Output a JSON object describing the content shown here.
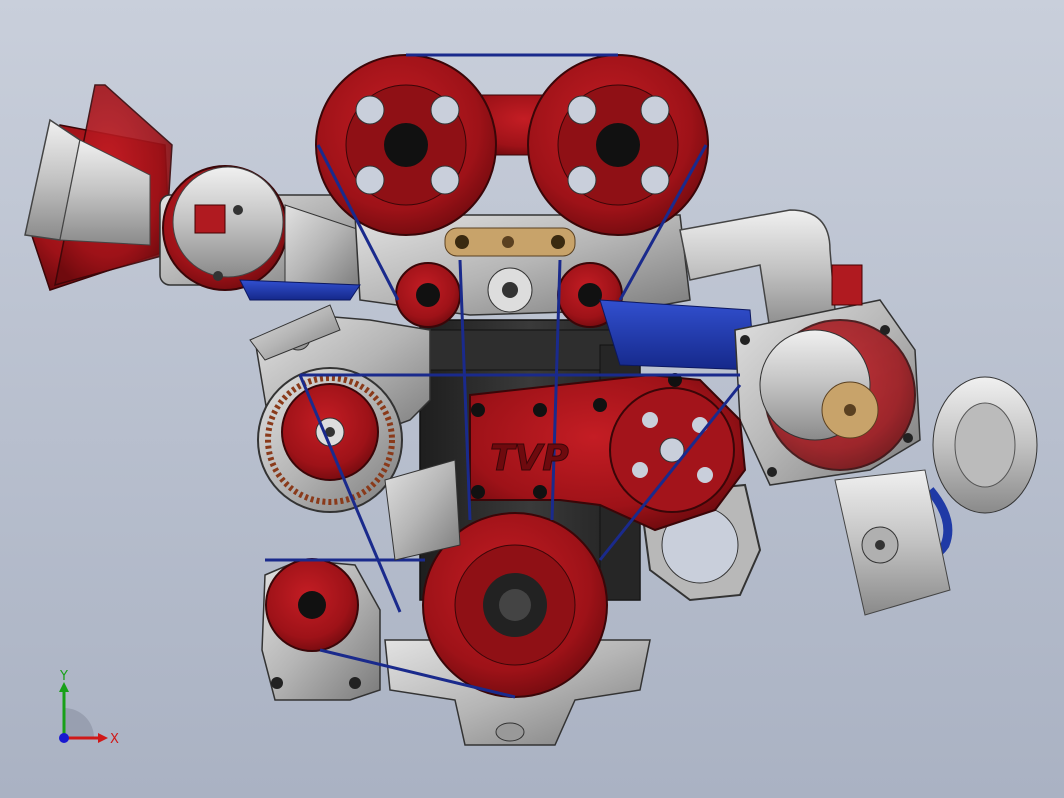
{
  "viewport": {
    "background_top": "#c9cfdb",
    "background_bottom": "#aab2c3"
  },
  "model": {
    "cover_logo_text": "TVP",
    "colors": {
      "red_primary": "#a8141a",
      "red_dark": "#6e0a0e",
      "steel": "#b8b8b8",
      "steel_dark": "#6f6f6f",
      "black_block": "#2a2a2a",
      "belt_blue": "#1a2a8c",
      "hose_blue": "#1f3aa6",
      "brass": "#c8a36a"
    }
  },
  "triad": {
    "x_label": "X",
    "y_label": "Y",
    "x_color": "#d01818",
    "y_color": "#18a018",
    "z_color": "#1818d0"
  }
}
